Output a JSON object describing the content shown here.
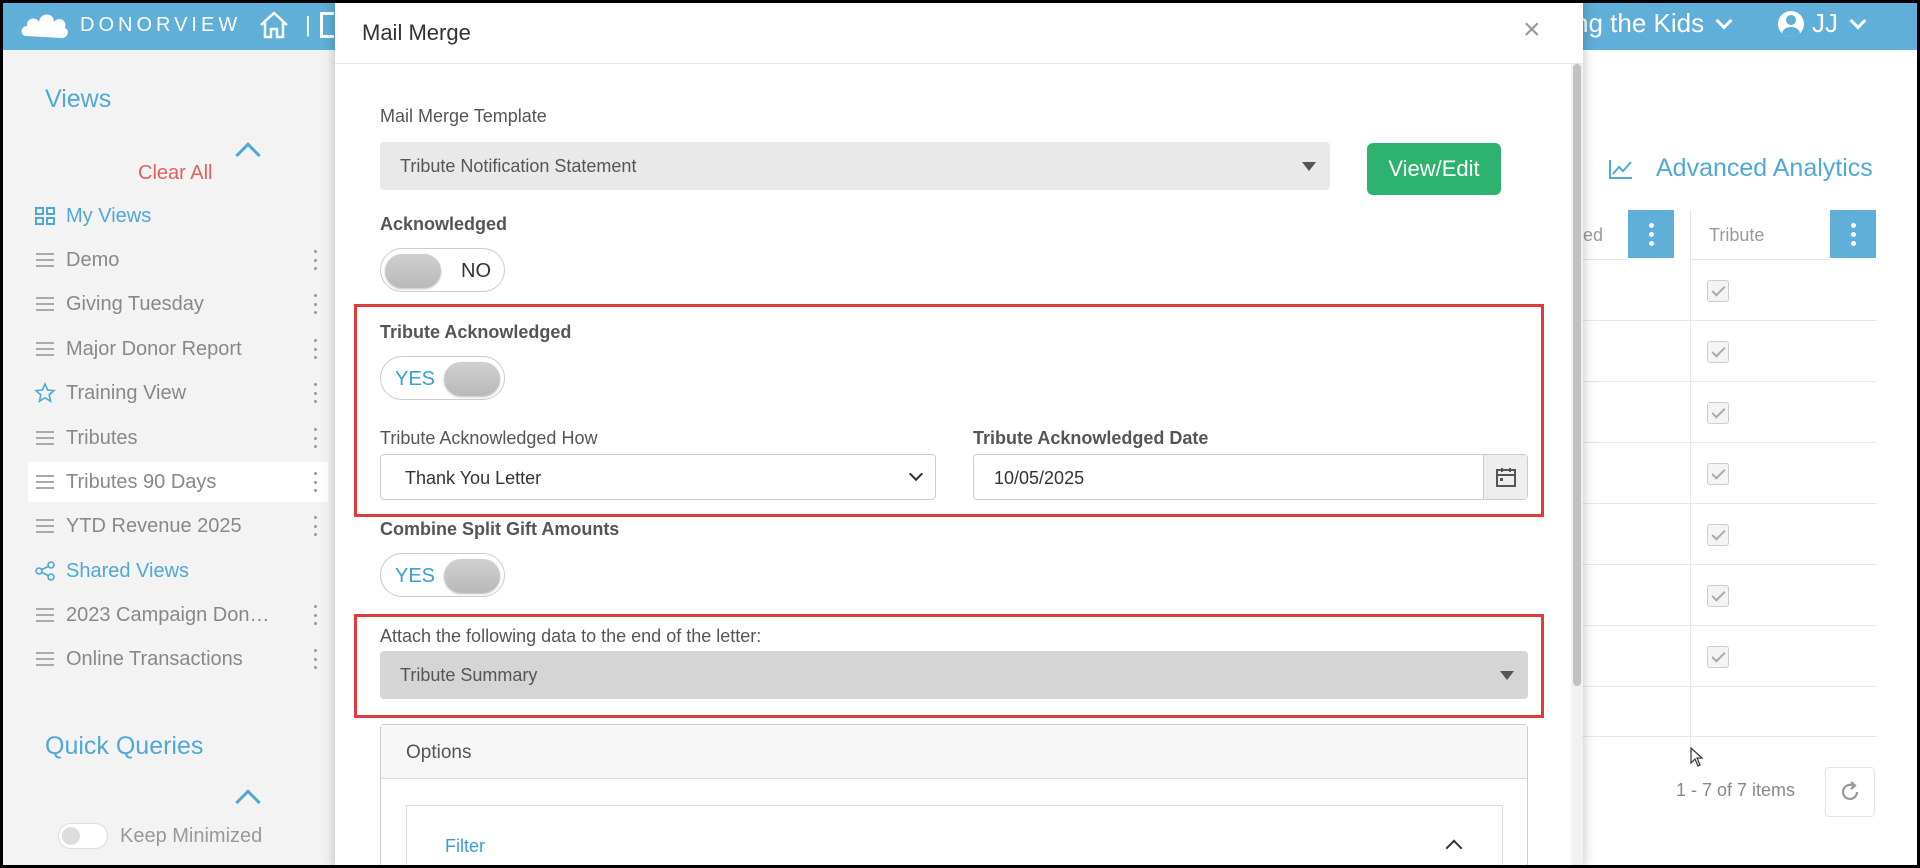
{
  "app": {
    "brand": "DONORVIEW",
    "org_name": "ng the Kids",
    "user_initials": "JJ"
  },
  "sidebar": {
    "views_title": "Views",
    "clear_all": "Clear All",
    "my_views": "My Views",
    "items": [
      {
        "label": "Demo"
      },
      {
        "label": "Giving Tuesday"
      },
      {
        "label": "Major Donor Report"
      },
      {
        "label": "Training View"
      },
      {
        "label": "Tributes"
      },
      {
        "label": "Tributes 90 Days"
      },
      {
        "label": "YTD Revenue 2025"
      }
    ],
    "shared_views": "Shared Views",
    "shared_items": [
      {
        "label": "2023 Campaign Don…"
      },
      {
        "label": "Online Transactions"
      }
    ],
    "quick_queries_title": "Quick Queries",
    "keep_minimized": "Keep Minimized"
  },
  "grid": {
    "advanced_analytics": "Advanced Analytics",
    "col_partial": "ed",
    "col_tribute": "Tribute",
    "rows_checked": [
      true,
      true,
      true,
      true,
      true,
      true,
      true
    ],
    "pager_text": "1 - 7 of 7 items"
  },
  "modal": {
    "title": "Mail Merge",
    "close": "×",
    "template_label": "Mail Merge Template",
    "template_value": "Tribute Notification Statement",
    "view_edit": "View/Edit",
    "acknowledged_label": "Acknowledged",
    "acknowledged_toggle": "NO",
    "tribute_ack_label": "Tribute Acknowledged",
    "tribute_ack_toggle": "YES",
    "ack_how_label": "Tribute Acknowledged How",
    "ack_how_value": "Thank You Letter",
    "ack_date_label": "Tribute Acknowledged Date",
    "ack_date_value": "10/05/2025",
    "combine_label": "Combine Split Gift Amounts",
    "combine_toggle": "YES",
    "attach_label": "Attach the following data to the end of the letter:",
    "attach_value": "Tribute Summary",
    "options_title": "Options",
    "filter_label": "Filter"
  },
  "colors": {
    "topbar": "#5fafd9",
    "accent": "#4fa8d6",
    "danger": "#e03a3a",
    "success": "#2db36f"
  }
}
